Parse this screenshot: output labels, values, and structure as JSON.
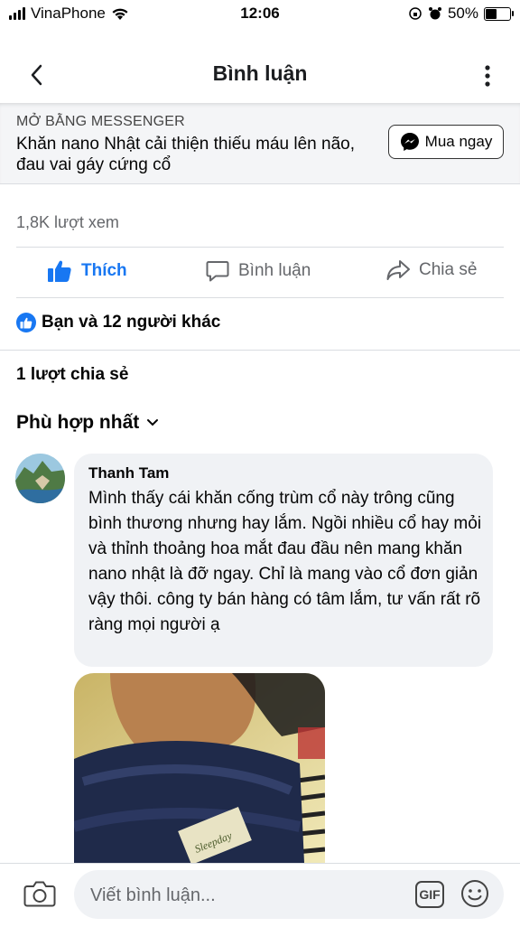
{
  "status_bar": {
    "carrier": "VinaPhone",
    "time": "12:06",
    "battery": "50%"
  },
  "header": {
    "title": "Bình luận"
  },
  "ad": {
    "kicker": "MỞ BẰNG MESSENGER",
    "text": "Khăn nano Nhật cải thiện thiếu máu lên não, đau vai gáy cứng cổ",
    "button_label": "Mua ngay"
  },
  "post": {
    "views": "1,8K lượt xem",
    "actions": {
      "like": "Thích",
      "comment": "Bình luận",
      "share": "Chia sẻ"
    },
    "reactions": "Bạn và 12 người khác",
    "shares": "1 lượt chia sẻ",
    "sort": "Phù hợp nhất"
  },
  "comment": {
    "author": "Thanh Tam",
    "text": "Mình thấy cái khăn cống trùm cổ này trông cũng bình thương nhưng hay lắm. Ngồi nhiều cổ hay mỏi và thỉnh thoảng hoa mắt đau đầu nên mang khăn nano nhật là đỡ ngay. Chỉ là mang vào cổ đơn giản vậy thôi. công ty bán hàng có tâm lắm, tư vấn rất rõ ràng mọi người ạ",
    "photo_label": "Sleepday"
  },
  "composer": {
    "placeholder": "Viết bình luận...",
    "gif_label": "GIF"
  },
  "colors": {
    "accent": "#1877f2",
    "text_secondary": "#65676b",
    "bubble": "#f0f2f5"
  },
  "icons": [
    "signal-icon",
    "wifi-icon",
    "battery-icon",
    "back-arrow-icon",
    "more-icon",
    "messenger-icon",
    "like-icon",
    "comment-icon",
    "share-icon",
    "chevron-down-icon",
    "camera-icon",
    "gif-icon",
    "emoji-icon"
  ]
}
